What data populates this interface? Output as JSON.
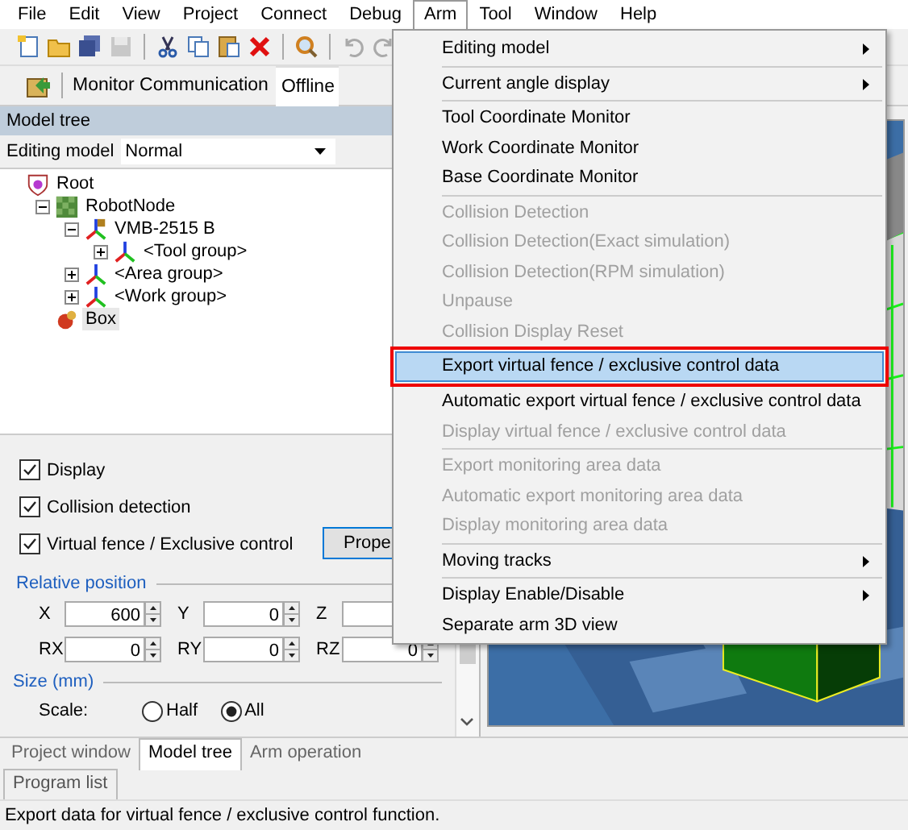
{
  "menu_bar": [
    {
      "label": "File",
      "selected": false
    },
    {
      "label": "Edit",
      "selected": false
    },
    {
      "label": "View",
      "selected": false
    },
    {
      "label": "Project",
      "selected": false
    },
    {
      "label": "Connect",
      "selected": false
    },
    {
      "label": "Debug",
      "selected": false
    },
    {
      "label": "Arm",
      "selected": true
    },
    {
      "label": "Tool",
      "selected": false
    },
    {
      "label": "Window",
      "selected": false
    },
    {
      "label": "Help",
      "selected": false
    }
  ],
  "toolbar": {
    "monitor_label": "Monitor Communication",
    "monitor_status": "Offline"
  },
  "model_panel": {
    "title": "Model tree",
    "editing_model_label": "Editing model",
    "editing_model_value": "Normal"
  },
  "tree": [
    {
      "label": "Root",
      "kind": "root",
      "selected": false,
      "children": [
        {
          "label": "RobotNode",
          "kind": "robot",
          "expanded": true,
          "selected": false,
          "children": [
            {
              "label": "VMB-2515 B",
              "kind": "arm",
              "expanded": true,
              "selected": false,
              "children": [
                {
                  "label": "<Tool group>",
                  "kind": "group",
                  "expanded": false,
                  "selected": false
                }
              ]
            },
            {
              "label": "<Area group>",
              "kind": "group",
              "expanded": false,
              "selected": false
            },
            {
              "label": "<Work group>",
              "kind": "group",
              "expanded": false,
              "selected": false
            }
          ]
        },
        {
          "label": "Box",
          "kind": "object",
          "selected": true
        }
      ]
    }
  ],
  "properties": {
    "checkboxes": [
      {
        "label": "Display",
        "checked": true
      },
      {
        "label": "Collision detection",
        "checked": true
      },
      {
        "label": "Virtual fence / Exclusive control",
        "checked": true
      }
    ],
    "button": "Prope",
    "position": {
      "title": "Relative position",
      "fields": [
        {
          "label": "X",
          "value": "600"
        },
        {
          "label": "Y",
          "value": "0"
        },
        {
          "label": "Z"
        },
        {
          "label": "RX",
          "value": "0"
        },
        {
          "label": "RY",
          "value": "0"
        },
        {
          "label": "RZ",
          "value": "0"
        }
      ]
    },
    "size": {
      "title": "Size (mm)",
      "scale_label": "Scale:",
      "options": [
        {
          "label": "Half",
          "selected": false
        },
        {
          "label": "All",
          "selected": true
        }
      ]
    }
  },
  "bottom_tabs": [
    {
      "label": "Project window",
      "selected": false
    },
    {
      "label": "Model tree",
      "selected": true
    },
    {
      "label": "Arm operation",
      "selected": false
    }
  ],
  "lower_tabs": [
    {
      "label": "Program list",
      "selected": true
    }
  ],
  "arm_menu": {
    "items": [
      {
        "kind": "submenu",
        "label": "Editing model",
        "disabled": false,
        "selected": false
      },
      {
        "kind": "separator"
      },
      {
        "kind": "submenu",
        "label": "Current angle display",
        "disabled": false,
        "selected": false
      },
      {
        "kind": "separator"
      },
      {
        "kind": "command",
        "label": "Tool Coordinate Monitor",
        "disabled": false,
        "selected": false
      },
      {
        "kind": "command",
        "label": "Work Coordinate Monitor",
        "disabled": false,
        "selected": false
      },
      {
        "kind": "command",
        "label": "Base Coordinate Monitor",
        "disabled": false,
        "selected": false
      },
      {
        "kind": "separator"
      },
      {
        "kind": "command",
        "label": "Collision Detection",
        "disabled": true,
        "selected": false
      },
      {
        "kind": "command",
        "label": "Collision Detection(Exact simulation)",
        "disabled": true,
        "selected": false
      },
      {
        "kind": "command",
        "label": "Collision Detection(RPM simulation)",
        "disabled": true,
        "selected": false
      },
      {
        "kind": "command",
        "label": "Unpause",
        "disabled": true,
        "selected": false
      },
      {
        "kind": "command",
        "label": "Collision Display Reset",
        "disabled": true,
        "selected": false
      },
      {
        "kind": "command",
        "label": "Export virtual fence / exclusive control data",
        "disabled": false,
        "selected": true
      },
      {
        "kind": "command",
        "label": "Automatic export virtual fence / exclusive control data",
        "disabled": false,
        "selected": false
      },
      {
        "kind": "command",
        "label": "Display virtual fence / exclusive control data",
        "disabled": true,
        "selected": false
      },
      {
        "kind": "separator"
      },
      {
        "kind": "command",
        "label": "Export monitoring area data",
        "disabled": true,
        "selected": false
      },
      {
        "kind": "command",
        "label": "Automatic export monitoring area data",
        "disabled": true,
        "selected": false
      },
      {
        "kind": "command",
        "label": "Display monitoring area data",
        "disabled": true,
        "selected": false
      },
      {
        "kind": "separator"
      },
      {
        "kind": "submenu",
        "label": "Moving tracks",
        "disabled": false,
        "selected": false
      },
      {
        "kind": "separator"
      },
      {
        "kind": "submenu",
        "label": "Display Enable/Disable",
        "disabled": false,
        "selected": false
      },
      {
        "kind": "command",
        "label": "Separate arm 3D view",
        "disabled": false,
        "selected": false
      }
    ]
  },
  "status_bar": "Export data for virtual fence  / exclusive control  function."
}
